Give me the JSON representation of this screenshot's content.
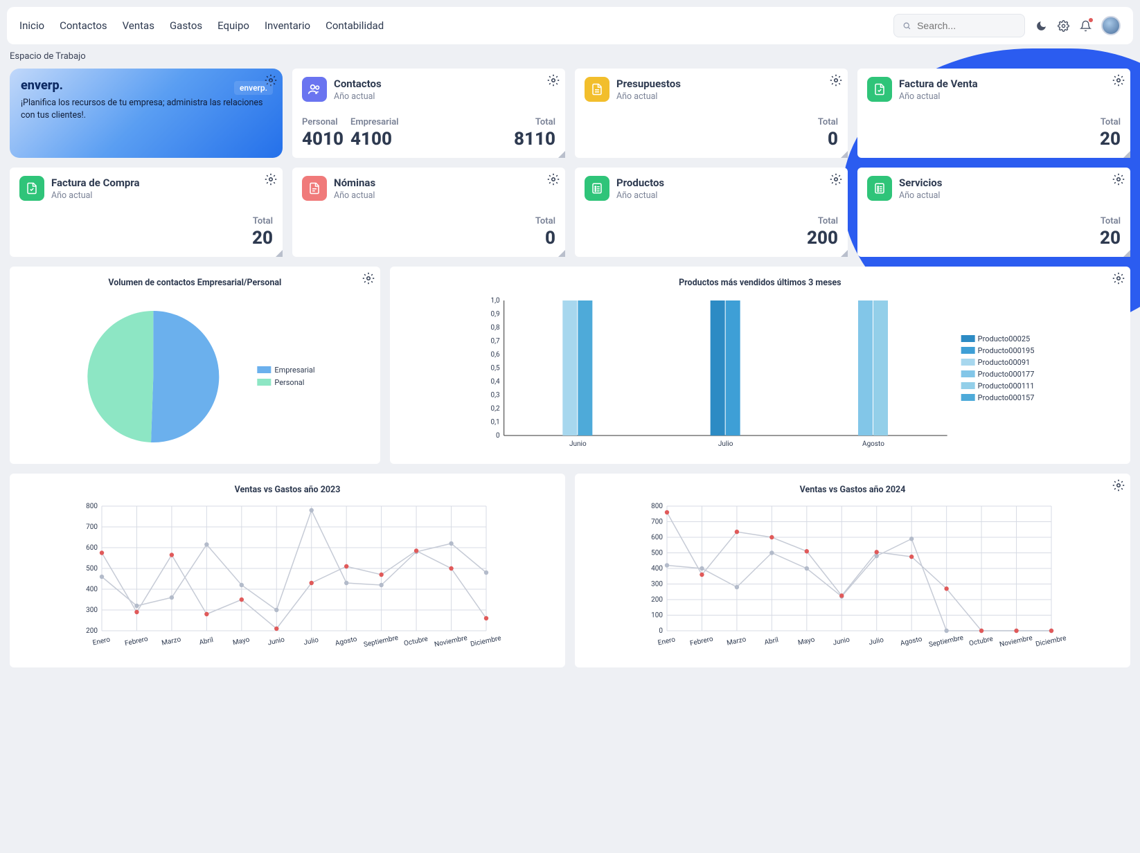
{
  "nav": {
    "items": [
      "Inicio",
      "Contactos",
      "Ventas",
      "Gastos",
      "Equipo",
      "Inventario",
      "Contabilidad"
    ],
    "search_placeholder": "Search..."
  },
  "workspace_label": "Espacio de Trabajo",
  "promo": {
    "brand": "enverp.",
    "badge": "enverp.",
    "tagline": "¡Planifica los recursos de tu empresa; administra las relaciones con tus clientes!."
  },
  "cards": {
    "contactos": {
      "title": "Contactos",
      "sub": "Año actual",
      "labels": {
        "personal": "Personal",
        "empresarial": "Empresarial",
        "total": "Total"
      },
      "values": {
        "personal": "4010",
        "empresarial": "4100",
        "total": "8110"
      }
    },
    "presupuestos": {
      "title": "Presupuestos",
      "sub": "Año actual",
      "total_label": "Total",
      "total": "0"
    },
    "factura_venta": {
      "title": "Factura de Venta",
      "sub": "Año actual",
      "total_label": "Total",
      "total": "20"
    },
    "factura_compra": {
      "title": "Factura de Compra",
      "sub": "Año actual",
      "total_label": "Total",
      "total": "20"
    },
    "nominas": {
      "title": "Nóminas",
      "sub": "Año actual",
      "total_label": "Total",
      "total": "0"
    },
    "productos": {
      "title": "Productos",
      "sub": "Año actual",
      "total_label": "Total",
      "total": "200"
    },
    "servicios": {
      "title": "Servicios",
      "sub": "Año actual",
      "total_label": "Total",
      "total": "20"
    }
  },
  "chart_data": [
    {
      "id": "pie_contacts",
      "type": "pie",
      "title": "Volumen de contactos Empresarial/Personal",
      "series": [
        {
          "name": "Empresarial",
          "value": 4100,
          "color": "#6bb0ed"
        },
        {
          "name": "Personal",
          "value": 4010,
          "color": "#8de6c4"
        }
      ]
    },
    {
      "id": "bar_products",
      "type": "bar",
      "title": "Productos más vendidos últimos 3 meses",
      "categories": [
        "Junio",
        "Julio",
        "Agosto"
      ],
      "ylim": [
        0,
        1.0
      ],
      "yticks": [
        0,
        0.1,
        0.2,
        0.3,
        0.4,
        0.5,
        0.6,
        0.7,
        0.8,
        0.9,
        1.0
      ],
      "series": [
        {
          "name": "Producto00025",
          "color": "#2d8bc4",
          "values": [
            0,
            1.0,
            0
          ]
        },
        {
          "name": "Producto000195",
          "color": "#3e9fd6",
          "values": [
            0,
            1.0,
            0
          ]
        },
        {
          "name": "Producto00091",
          "color": "#a7d7ee",
          "values": [
            1.0,
            0,
            0
          ]
        },
        {
          "name": "Producto000177",
          "color": "#82c6e8",
          "values": [
            0,
            0,
            1.0
          ]
        },
        {
          "name": "Producto000111",
          "color": "#93cfe9",
          "values": [
            0,
            0,
            1.0
          ]
        },
        {
          "name": "Producto000157",
          "color": "#4eaad9",
          "values": [
            1.0,
            0,
            0
          ]
        }
      ]
    },
    {
      "id": "line_2023",
      "type": "line",
      "title": "Ventas vs Gastos año 2023",
      "categories": [
        "Enero",
        "Febrero",
        "Marzo",
        "Abril",
        "Mayo",
        "Junio",
        "Julio",
        "Agosto",
        "Septiembre",
        "Octubre",
        "Noviembre",
        "Diciembre"
      ],
      "ylim": [
        200,
        800
      ],
      "yticks": [
        200,
        300,
        400,
        500,
        600,
        700,
        800
      ],
      "series": [
        {
          "name": "Ventas",
          "color": "#c6cbd6",
          "point_color": "#b3bbca",
          "values": [
            460,
            320,
            360,
            615,
            420,
            300,
            780,
            430,
            420,
            580,
            620,
            480
          ]
        },
        {
          "name": "Gastos",
          "color": "#c6cbd6",
          "point_color": "#e05a5a",
          "values": [
            575,
            290,
            565,
            280,
            350,
            210,
            430,
            510,
            470,
            585,
            500,
            260
          ]
        }
      ]
    },
    {
      "id": "line_2024",
      "type": "line",
      "title": "Ventas vs Gastos año 2024",
      "categories": [
        "Enero",
        "Febrero",
        "Marzo",
        "Abril",
        "Mayo",
        "Junio",
        "Julio",
        "Agosto",
        "Septiembre",
        "Octubre",
        "Noviembre",
        "Diciembre"
      ],
      "ylim": [
        0,
        800
      ],
      "yticks": [
        0,
        100,
        200,
        300,
        400,
        500,
        600,
        700,
        800
      ],
      "series": [
        {
          "name": "Ventas",
          "color": "#c6cbd6",
          "point_color": "#b3bbca",
          "values": [
            420,
            400,
            280,
            500,
            400,
            220,
            480,
            590,
            0,
            0,
            0,
            0
          ]
        },
        {
          "name": "Gastos",
          "color": "#c6cbd6",
          "point_color": "#e05a5a",
          "values": [
            760,
            360,
            635,
            600,
            510,
            225,
            505,
            475,
            270,
            0,
            0,
            0
          ]
        }
      ]
    }
  ]
}
